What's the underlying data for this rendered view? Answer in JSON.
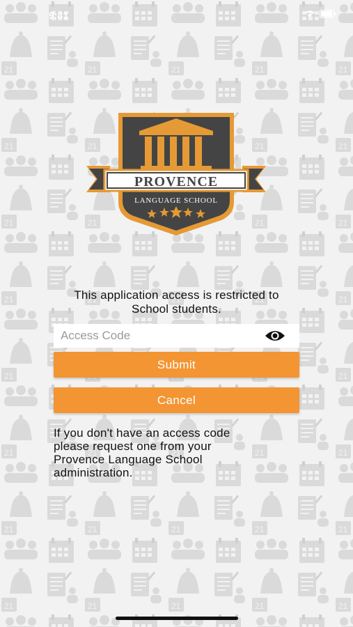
{
  "status_bar": {
    "time": "9:41"
  },
  "logo": {
    "line1": "PROVENCE",
    "line2": "LANGUAGE SCHOOL"
  },
  "message": {
    "line1": "This application access is restricted to",
    "line2": "School students."
  },
  "access_code": {
    "placeholder": "Access Code",
    "value": ""
  },
  "buttons": {
    "submit": "Submit",
    "cancel": "Cancel"
  },
  "help": {
    "line1": "If you don't have an access code",
    "line2": "please request one from your",
    "line3": "Provence Language School",
    "line4": "administration."
  },
  "colors": {
    "accent": "#f39533",
    "logo_gold": "#e59a35",
    "logo_dark": "#444444",
    "background": "#f2f2f2",
    "pattern": "#d9d9d9"
  },
  "icons": [
    "eye-icon",
    "columns-icon",
    "star-icon",
    "wifi-icon",
    "battery-icon"
  ]
}
